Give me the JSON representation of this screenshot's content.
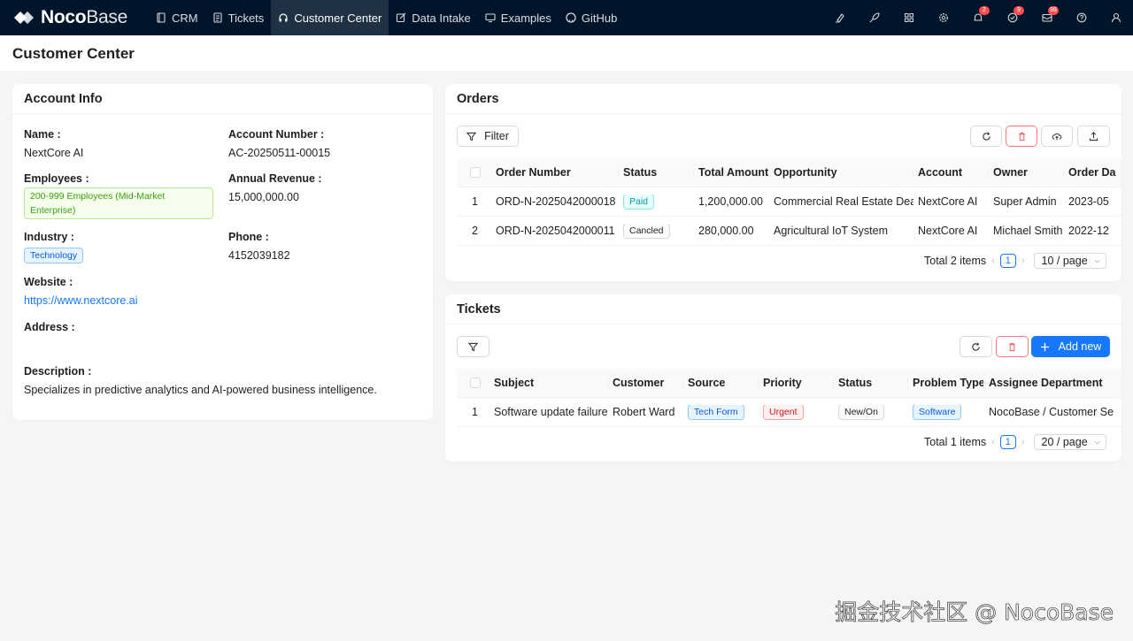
{
  "app": {
    "logo_bold": "Noco",
    "logo_light": "Base"
  },
  "nav": {
    "items": [
      {
        "label": "CRM",
        "icon": "book-icon"
      },
      {
        "label": "Tickets",
        "icon": "file-text-icon"
      },
      {
        "label": "Customer Center",
        "icon": "headphones-icon",
        "active": true
      },
      {
        "label": "Data Intake",
        "icon": "edit-icon"
      },
      {
        "label": "Examples",
        "icon": "desktop-icon"
      },
      {
        "label": "GitHub",
        "icon": "github-icon"
      }
    ],
    "right_icons": [
      {
        "name": "highlighter-icon"
      },
      {
        "name": "rocket-icon"
      },
      {
        "name": "grid-icon"
      },
      {
        "name": "settings-icon"
      },
      {
        "name": "bell-icon",
        "badge": "2"
      },
      {
        "name": "check-circle-icon",
        "badge": "9"
      },
      {
        "name": "mail-icon",
        "badge": "98"
      },
      {
        "name": "help-icon"
      },
      {
        "name": "user-icon"
      }
    ]
  },
  "page": {
    "title": "Customer Center"
  },
  "account": {
    "title": "Account Info",
    "name_label": "Name",
    "name": "NextCore AI",
    "account_number_label": "Account Number",
    "account_number": "AC-20250511-00015",
    "employees_label": "Employees",
    "employees": "200-999 Employees (Mid-Market Enterprise)",
    "annual_revenue_label": "Annual Revenue",
    "annual_revenue": "15,000,000.00",
    "industry_label": "Industry",
    "industry": "Technology",
    "phone_label": "Phone",
    "phone": "4152039182",
    "website_label": "Website",
    "website": "https://www.nextcore.ai",
    "address_label": "Address",
    "description_label": "Description",
    "description": "Specializes in predictive analytics and AI-powered business intelligence."
  },
  "orders": {
    "title": "Orders",
    "filter_label": "Filter",
    "columns": [
      "Order Number",
      "Status",
      "Total Amount",
      "Opportunity",
      "Account",
      "Owner",
      "Order Da"
    ],
    "rows": [
      {
        "index": "1",
        "order_number": "ORD-N-2025042000018",
        "status": "Paid",
        "total": "1,200,000.00",
        "opportunity": "Commercial Real Estate Deal",
        "account": "NextCore AI",
        "owner": "Super Admin",
        "order_date": "2023-05"
      },
      {
        "index": "2",
        "order_number": "ORD-N-2025042000011",
        "status": "Cancled",
        "total": "280,000.00",
        "opportunity": "Agricultural IoT System",
        "account": "NextCore AI",
        "owner": "Michael Smith",
        "order_date": "2022-12"
      }
    ],
    "total_text": "Total 2 items",
    "page": "1",
    "page_size": "10 / page"
  },
  "tickets": {
    "title": "Tickets",
    "add_new_label": "Add new",
    "columns": [
      "Subject",
      "Customer",
      "Source",
      "Priority",
      "Status",
      "Problem Type",
      "Assignee Department"
    ],
    "rows": [
      {
        "index": "1",
        "subject": "Software update failure",
        "customer": "Robert Ward",
        "source": "Tech Form",
        "priority": "Urgent",
        "status": "New/On",
        "problem_type": "Software",
        "department": "NocoBase / Customer Se"
      }
    ],
    "total_text": "Total 1 items",
    "page": "1",
    "page_size": "20 / page"
  },
  "watermark": "掘金技术社区 @ NocoBase",
  "colors": {
    "nav_bg": "#001529",
    "primary": "#1677ff",
    "danger": "#ff4d4f"
  }
}
